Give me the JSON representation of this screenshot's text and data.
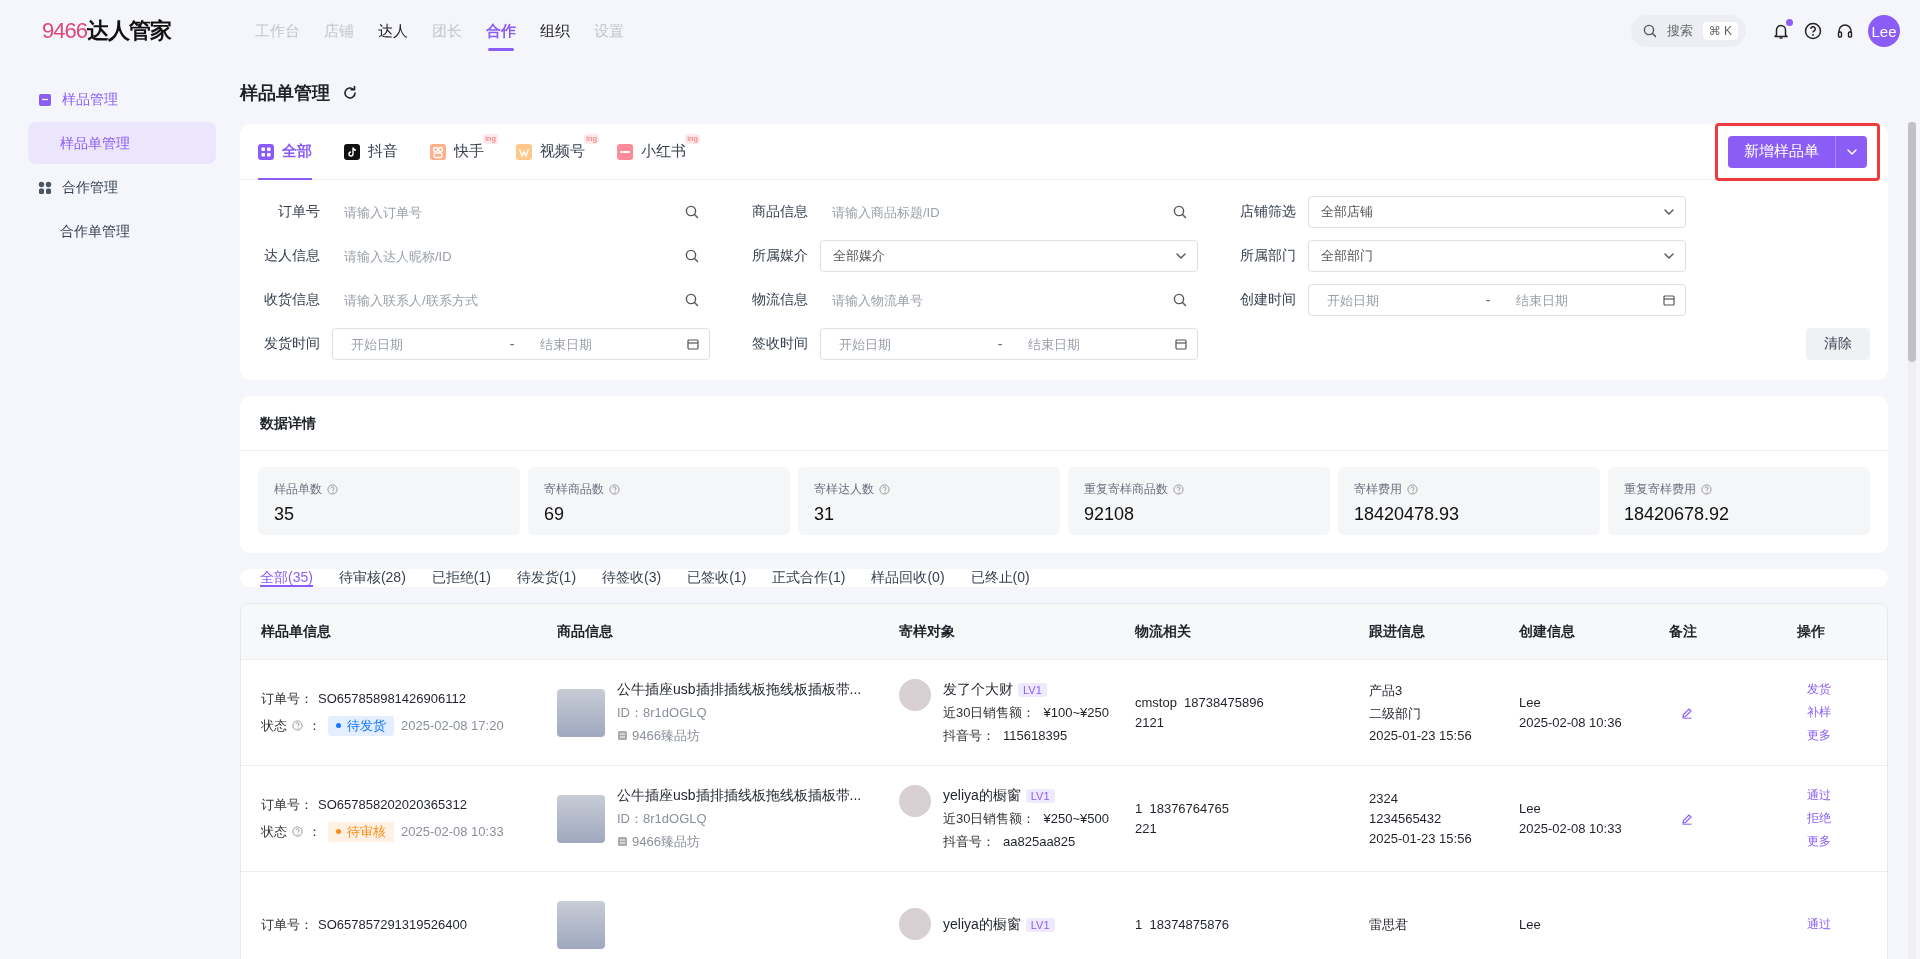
{
  "logo": {
    "number": "9466",
    "name": "达人管家"
  },
  "nav": [
    {
      "label": "工作台",
      "selected": false,
      "disabled": true
    },
    {
      "label": "店铺",
      "selected": false,
      "disabled": true
    },
    {
      "label": "达人",
      "selected": false,
      "disabled": false
    },
    {
      "label": "团长",
      "selected": false,
      "disabled": true
    },
    {
      "label": "合作",
      "selected": true,
      "disabled": false
    },
    {
      "label": "组织",
      "selected": false,
      "disabled": false
    },
    {
      "label": "设置",
      "selected": false,
      "disabled": true
    }
  ],
  "search": {
    "placeholder": "搜索",
    "shortcut": "⌘ K"
  },
  "notifications": {
    "unread": true
  },
  "user": {
    "avatar_text": "Lee"
  },
  "sidebar": {
    "groups": [
      {
        "label": "样品管理",
        "active": true,
        "kind": "box",
        "children": [
          {
            "label": "样品单管理",
            "selected": true
          }
        ]
      },
      {
        "label": "合作管理",
        "active": false,
        "kind": "grid",
        "children": [
          {
            "label": "合作单管理",
            "selected": false
          }
        ]
      }
    ]
  },
  "page_title": "样品单管理",
  "platform_tabs": [
    {
      "label": "全部",
      "kind": "all",
      "selected": true
    },
    {
      "label": "抖音",
      "kind": "douyin",
      "selected": false
    },
    {
      "label": "快手",
      "kind": "kuaishou",
      "selected": false,
      "badge": "ing"
    },
    {
      "label": "视频号",
      "kind": "channels",
      "selected": false,
      "badge": "ing"
    },
    {
      "label": "小红书",
      "kind": "xiaohongshu",
      "selected": false,
      "badge": "ing"
    }
  ],
  "create_button": {
    "label": "新增样品单",
    "highlighted": true
  },
  "filters": [
    {
      "label": "订单号",
      "kind": "search",
      "placeholder": "请输入订单号"
    },
    {
      "label": "商品信息",
      "kind": "search",
      "placeholder": "请输入商品标题/ID"
    },
    {
      "label": "店铺筛选",
      "kind": "select",
      "value": "全部店铺"
    },
    {
      "label": "达人信息",
      "kind": "search",
      "placeholder": "请输入达人昵称/ID"
    },
    {
      "label": "所属媒介",
      "kind": "select",
      "value": "全部媒介"
    },
    {
      "label": "所属部门",
      "kind": "select",
      "value": "全部部门"
    },
    {
      "label": "收货信息",
      "kind": "search",
      "placeholder": "请输入联系人/联系方式"
    },
    {
      "label": "物流信息",
      "kind": "search",
      "placeholder": "请输入物流单号"
    },
    {
      "label": "创建时间",
      "kind": "daterange",
      "start_placeholder": "开始日期",
      "separator": "-",
      "end_placeholder": "结束日期"
    },
    {
      "label": "发货时间",
      "kind": "daterange",
      "start_placeholder": "开始日期",
      "separator": "-",
      "end_placeholder": "结束日期"
    },
    {
      "label": "签收时间",
      "kind": "daterange",
      "start_placeholder": "开始日期",
      "separator": "-",
      "end_placeholder": "结束日期"
    }
  ],
  "clear_button": "清除",
  "stats": {
    "title": "数据详情",
    "items": [
      {
        "label": "样品单数",
        "value": "35"
      },
      {
        "label": "寄样商品数",
        "value": "69"
      },
      {
        "label": "寄样达人数",
        "value": "31"
      },
      {
        "label": "重复寄样商品数",
        "value": "92108"
      },
      {
        "label": "寄样费用",
        "value": "18420478.93"
      },
      {
        "label": "重复寄样费用",
        "value": "18420678.92"
      }
    ]
  },
  "status_tabs": [
    {
      "label": "全部(35)",
      "selected": true
    },
    {
      "label": "待审核(28)",
      "selected": false
    },
    {
      "label": "已拒绝(1)",
      "selected": false
    },
    {
      "label": "待发货(1)",
      "selected": false
    },
    {
      "label": "待签收(3)",
      "selected": false
    },
    {
      "label": "已签收(1)",
      "selected": false
    },
    {
      "label": "正式合作(1)",
      "selected": false
    },
    {
      "label": "样品回收(0)",
      "selected": false
    },
    {
      "label": "已终止(0)",
      "selected": false
    }
  ],
  "table": {
    "columns": [
      "样品单信息",
      "商品信息",
      "寄样对象",
      "物流相关",
      "跟进信息",
      "创建信息",
      "备注",
      "操作"
    ],
    "rows": [
      {
        "order_label": "订单号：",
        "order_no": "SO657858981426906112",
        "status_label": "状态",
        "status_suffix": "：",
        "status": {
          "text": "待发货",
          "color": "#1677ff"
        },
        "status_time": "2025-02-08 17:20",
        "product": {
          "title": "公牛插座usb插排插线板拖线板插板带...",
          "id": "ID：8r1dOGLQ",
          "shop": "9466臻品坊"
        },
        "target": {
          "name": "发了个大财",
          "level": "LV1",
          "sales_label": "近30日销售额：",
          "sales": "¥100~¥250",
          "account_label": "抖音号：",
          "account": "115618395"
        },
        "logistics": [
          "cmstop  18738475896",
          "2121"
        ],
        "followup": [
          "产品3",
          "二级部门",
          "2025-01-23 15:56"
        ],
        "created": [
          "Lee",
          "2025-02-08 10:36"
        ],
        "note_editable": true,
        "actions": [
          "发货",
          "补样",
          "更多"
        ]
      },
      {
        "order_label": "订单号：",
        "order_no": "SO657858202020365312",
        "status_label": "状态",
        "status_suffix": "：",
        "status": {
          "text": "待审核",
          "color": "#fa8c16"
        },
        "status_time": "2025-02-08 10:33",
        "product": {
          "title": "公牛插座usb插排插线板拖线板插板带...",
          "id": "ID：8r1dOGLQ",
          "shop": "9466臻品坊"
        },
        "target": {
          "name": "yeliya的橱窗",
          "level": "LV1",
          "sales_label": "近30日销售额：",
          "sales": "¥250~¥500",
          "account_label": "抖音号：",
          "account": "aa825aa825"
        },
        "logistics": [
          "1  18376764765",
          "221"
        ],
        "followup": [
          "2324",
          "1234565432",
          "2025-01-23 15:56"
        ],
        "created": [
          "Lee",
          "2025-02-08 10:33"
        ],
        "note_editable": true,
        "actions": [
          "通过",
          "拒绝",
          "更多"
        ]
      },
      {
        "order_label": "订单号：",
        "order_no": "SO657857291319526400",
        "product": {},
        "target": {
          "name": "yeliya的橱窗",
          "level": "LV1"
        },
        "logistics": [
          "1  18374875876"
        ],
        "followup": [
          "雷思君"
        ],
        "created": [
          "Lee"
        ],
        "actions": [
          "通过"
        ]
      }
    ]
  }
}
